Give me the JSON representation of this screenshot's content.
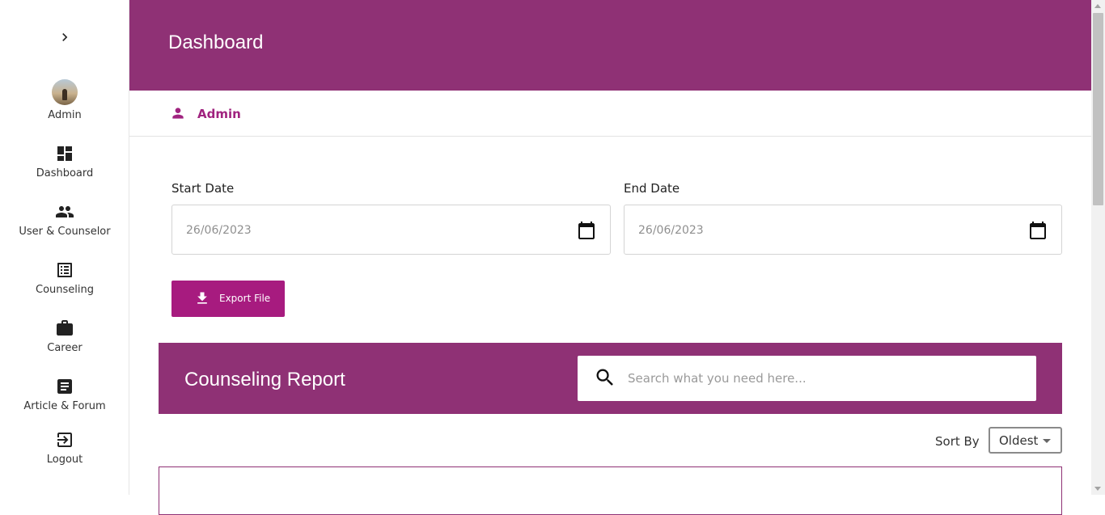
{
  "sidebar": {
    "items": [
      {
        "label": "Admin",
        "icon": "avatar"
      },
      {
        "label": "Dashboard",
        "icon": "dashboard-icon"
      },
      {
        "label": "User & Counselor",
        "icon": "people-icon"
      },
      {
        "label": "Counseling",
        "icon": "list-icon"
      },
      {
        "label": "Career",
        "icon": "briefcase-icon"
      },
      {
        "label": "Article & Forum",
        "icon": "article-icon"
      },
      {
        "label": "Logout",
        "icon": "logout-icon"
      }
    ]
  },
  "header": {
    "title": "Dashboard"
  },
  "user": {
    "name": "Admin"
  },
  "filters": {
    "start_label": "Start Date",
    "start_value": "26/06/2023",
    "end_label": "End Date",
    "end_value": "26/06/2023"
  },
  "export": {
    "label": "Export File"
  },
  "report": {
    "title": "Counseling Report",
    "search_placeholder": "Search what you need here..."
  },
  "sort": {
    "label": "Sort By",
    "value": "Oldest"
  },
  "colors": {
    "primary": "#8f3175",
    "accent": "#a71b7f"
  }
}
